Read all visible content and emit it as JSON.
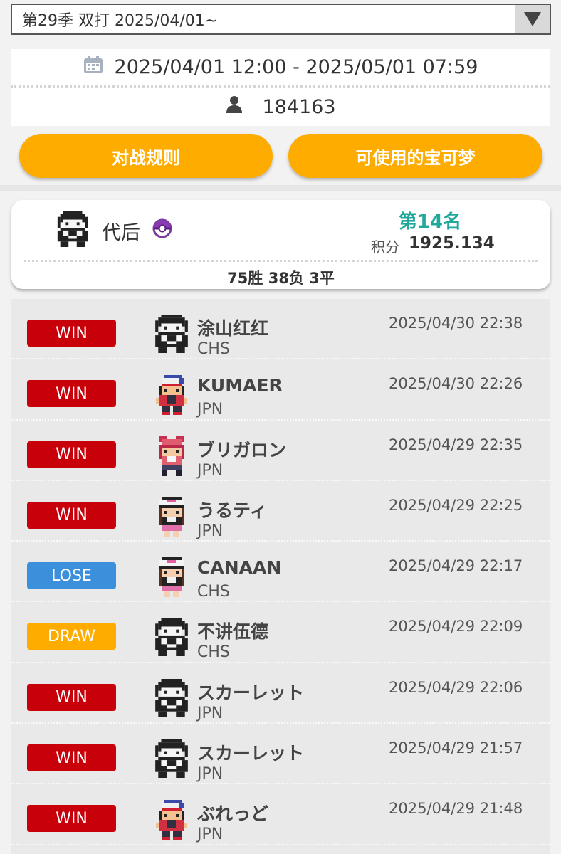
{
  "season": {
    "label": "第29季 双打 2025/04/01~",
    "arrow_icon": "triangle-down-icon"
  },
  "info": {
    "period": "2025/04/01 12:00 - 2025/05/01 07:59",
    "participants": "184163"
  },
  "buttons": {
    "rules": "对战规则",
    "pokemon": "可使用的宝可梦"
  },
  "player": {
    "name": "代后",
    "rank": "第14名",
    "score_label": "积分",
    "score": "1925.134",
    "record": "75胜 38负 3平"
  },
  "colors": {
    "accent": "#ffac00",
    "win": "#c8000a",
    "lose": "#3c8fda",
    "draw": "#ffac00",
    "rank": "#22a89a"
  },
  "battles": [
    {
      "result": "WIN",
      "name": "涂山红红",
      "country": "CHS",
      "time": "2025/04/30 22:38",
      "avatar": "black-hair-trainer"
    },
    {
      "result": "WIN",
      "name": "KUMAER",
      "country": "JPN",
      "time": "2025/04/30 22:26",
      "avatar": "white-cap-trainer"
    },
    {
      "result": "WIN",
      "name": "ブリガロン",
      "country": "JPN",
      "time": "2025/04/29 22:35",
      "avatar": "pink-hair-trainer"
    },
    {
      "result": "WIN",
      "name": "うるティ",
      "country": "JPN",
      "time": "2025/04/29 22:25",
      "avatar": "white-hat-girl-trainer"
    },
    {
      "result": "LOSE",
      "name": "CANAAN",
      "country": "CHS",
      "time": "2025/04/29 22:17",
      "avatar": "white-hat-girl-trainer"
    },
    {
      "result": "DRAW",
      "name": "不讲伍德",
      "country": "CHS",
      "time": "2025/04/29 22:09",
      "avatar": "black-hair-trainer"
    },
    {
      "result": "WIN",
      "name": "スカーレット",
      "country": "JPN",
      "time": "2025/04/29 22:06",
      "avatar": "black-hair-trainer"
    },
    {
      "result": "WIN",
      "name": "スカーレット",
      "country": "JPN",
      "time": "2025/04/29 21:57",
      "avatar": "black-hair-trainer"
    },
    {
      "result": "WIN",
      "name": "ぶれっど",
      "country": "JPN",
      "time": "2025/04/29 21:48",
      "avatar": "white-cap-trainer"
    }
  ]
}
